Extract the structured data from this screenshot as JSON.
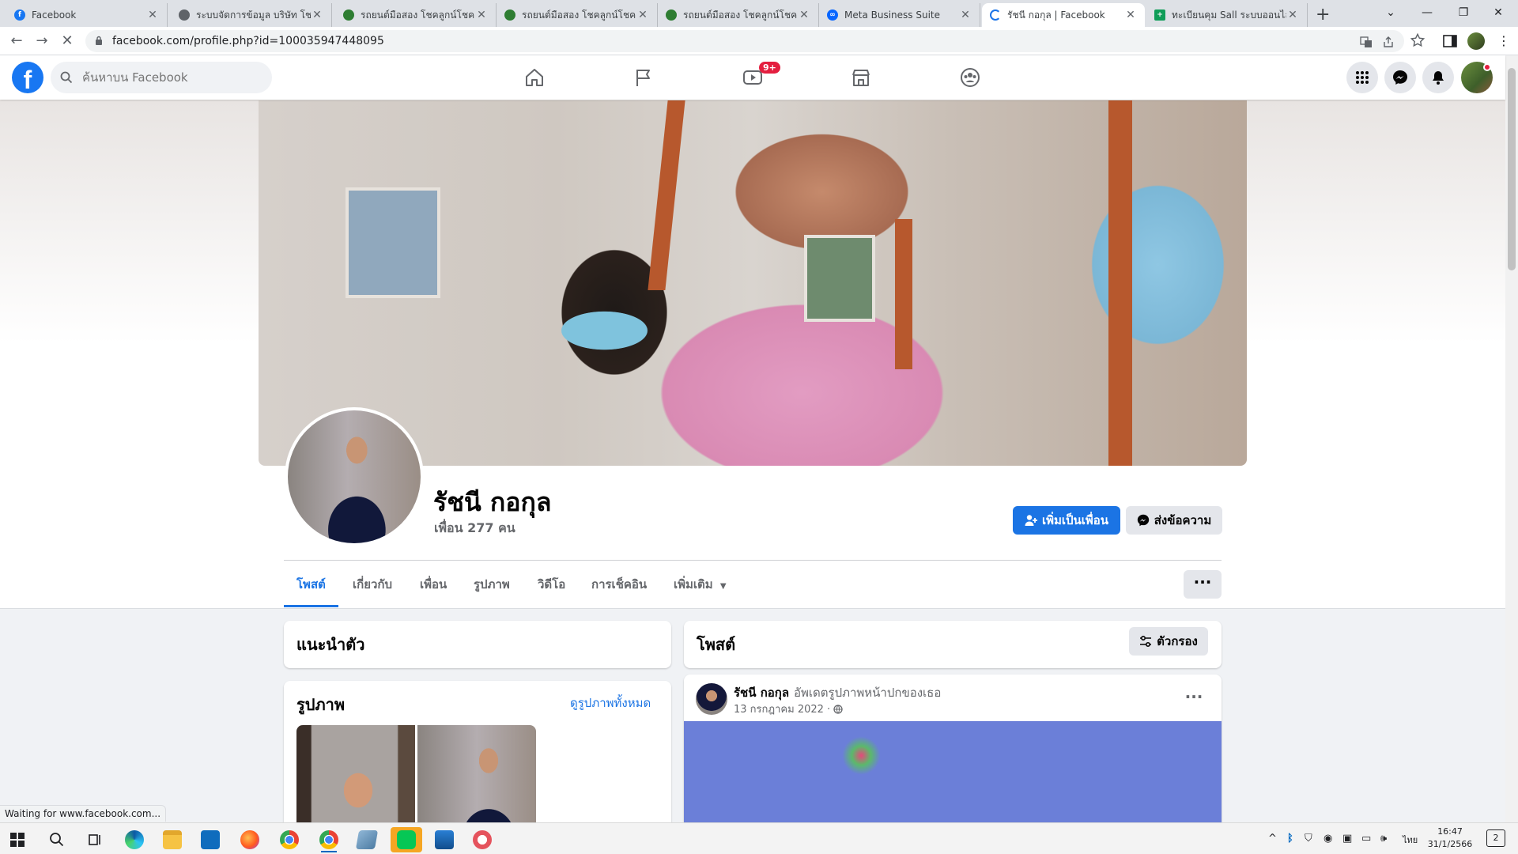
{
  "browser": {
    "tabs": [
      {
        "title": "Facebook",
        "favicon_color": "#1877f2",
        "active": false
      },
      {
        "title": "ระบบจัดการข้อมูล บริษัท โชคลู",
        "favicon_color": "#5f6368",
        "active": false
      },
      {
        "title": "รถยนต์มือสอง โชคลูกน์โชค อุดร",
        "favicon_color": "#2e7d32",
        "active": false
      },
      {
        "title": "รถยนต์มือสอง โชคลูกน์โชค อุดร",
        "favicon_color": "#2e7d32",
        "active": false
      },
      {
        "title": "รถยนต์มือสอง โชคลูกน์โชค อุดร",
        "favicon_color": "#2e7d32",
        "active": false
      },
      {
        "title": "Meta Business Suite",
        "favicon_color": "#0866ff",
        "active": false
      },
      {
        "title": "รัชนี กอกุล | Facebook",
        "favicon_color": "#1877f2",
        "active": true
      },
      {
        "title": "ทะเบียนคุม Sall ระบบออนไลน์",
        "favicon_color": "#0f9d58",
        "active": false
      }
    ],
    "url": "facebook.com/profile.php?id=100035947448095",
    "status_text": "Waiting for www.facebook.com..."
  },
  "fb": {
    "logo": "f",
    "search_placeholder": "ค้นหาบน Facebook",
    "watch_badge": "9+",
    "nav_icons": [
      "home-icon",
      "flag-icon",
      "video-icon",
      "marketplace-icon",
      "groups-icon"
    ],
    "brand_color": "#1877f2"
  },
  "profile": {
    "name": "รัชนี กอกุล",
    "friends": "เพื่อน 277 คน",
    "add_friend": "เพิ่มเป็นเพื่อน",
    "message": "ส่งข้อความ",
    "tabs": [
      "โพสต์",
      "เกี่ยวกับ",
      "เพื่อน",
      "รูปภาพ",
      "วิดีโอ",
      "การเช็คอิน",
      "เพิ่มเติม"
    ],
    "more_dots": "···"
  },
  "intro": {
    "title": "แนะนำตัว"
  },
  "photos": {
    "title": "รูปภาพ",
    "see_all": "ดูรูปภาพทั้งหมด"
  },
  "posts": {
    "title": "โพสต์",
    "filter": "ตัวกรอง",
    "items": [
      {
        "author": "รัชนี กอกุล",
        "action": "อัพเดตรูปภาพหน้าปกของเธอ",
        "date": "13 กรกฎาคม 2022 ·",
        "dots": "···"
      }
    ]
  },
  "taskbar": {
    "lang": "ไทย",
    "time": "16:47",
    "date": "31/1/2566",
    "notifications": "2"
  }
}
